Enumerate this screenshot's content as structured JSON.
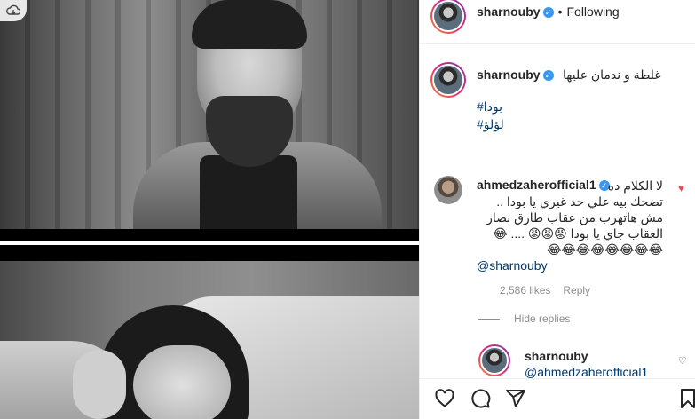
{
  "post": {
    "author": "sharnouby",
    "follow_status": "Following",
    "separator": "•",
    "caption": "غلطة و ندمان عليها",
    "hashtags": [
      "#بودا",
      "#لؤلؤ"
    ]
  },
  "comment": {
    "author": "ahmedzaherofficial1",
    "lines": [
      "لا الكلام ده",
      "تضحك بيه علي حد غيري يا بودا ..",
      "مش هاتهرب من عقاب طارق نصار",
      "العقاب جاي يا بودا 😡😡😡 .... 😂",
      "😂😂😂😂😂😂😂😂"
    ],
    "mention": "@sharnouby",
    "likes": "2,586 likes",
    "reply_label": "Reply",
    "hide_replies": "Hide replies"
  },
  "reply": {
    "author": "sharnouby",
    "mention": "@ahmedzaherofficial1"
  },
  "icons": {
    "verified": "verified-badge-icon",
    "heart": "heart-icon",
    "comment": "comment-icon",
    "share": "share-icon",
    "save": "bookmark-icon",
    "cloud": "cloud-download-icon"
  },
  "colors": {
    "verified": "#3897f0",
    "link": "#00376b",
    "like_red": "#ed4956",
    "muted": "#8e8e8e"
  }
}
